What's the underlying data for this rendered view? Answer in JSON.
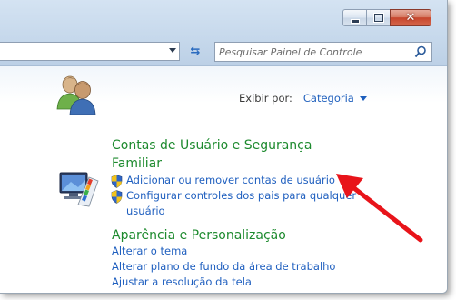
{
  "window": {
    "minimize_icon": "minimize-icon",
    "maximize_icon": "maximize-icon",
    "close_icon": "close-icon",
    "close_glyph": "✕"
  },
  "toolbar": {
    "refresh_icon": "refresh-icon",
    "refresh_glyph": "⇆",
    "search": {
      "placeholder": "Pesquisar Painel de Controle"
    }
  },
  "view": {
    "label": "Exibir por:",
    "value": "Categoria"
  },
  "categories": [
    {
      "title_line1": "Contas de Usuário e Segurança",
      "title_line2": "Familiar",
      "links": [
        {
          "label": "Adicionar ou remover contas de usuário",
          "shield": true
        },
        {
          "label_line1": "Configurar controles dos pais para qualquer",
          "label_line2": "usuário",
          "shield": true
        }
      ]
    },
    {
      "title": "Aparência e Personalização",
      "links": [
        {
          "label": "Alterar o tema"
        },
        {
          "label": "Alterar plano de fundo da área de trabalho"
        },
        {
          "label": "Ajustar a resolução da tela"
        }
      ]
    }
  ],
  "colors": {
    "category_title": "#1d8a2e",
    "link": "#1f5fbf",
    "annotation_arrow": "#e8141a"
  }
}
